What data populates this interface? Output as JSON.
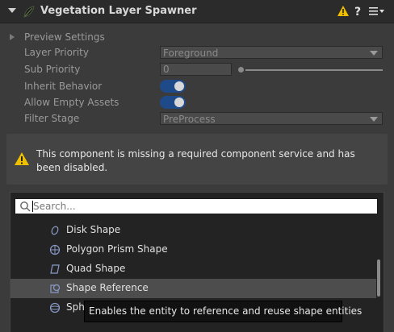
{
  "header": {
    "title": "Vegetation Layer Spawner",
    "warning_icon": "warning-icon",
    "help_icon": "help-icon",
    "menu_icon": "menu-icon"
  },
  "properties": {
    "preview_settings": "Preview Settings",
    "layer_priority": {
      "label": "Layer Priority",
      "value": "Foreground"
    },
    "sub_priority": {
      "label": "Sub Priority",
      "value": "0"
    },
    "inherit_behavior": {
      "label": "Inherit Behavior",
      "on": true
    },
    "allow_empty_assets": {
      "label": "Allow Empty Assets",
      "on": true
    },
    "filter_stage": {
      "label": "Filter Stage",
      "value": "PreProcess"
    }
  },
  "warning": {
    "message": "This component is missing a required component service and has been disabled."
  },
  "picker": {
    "search_placeholder": "Search...",
    "items": [
      {
        "label": "Disk Shape",
        "icon": "disk-shape-icon"
      },
      {
        "label": "Polygon Prism Shape",
        "icon": "polygon-prism-icon"
      },
      {
        "label": "Quad Shape",
        "icon": "quad-shape-icon"
      },
      {
        "label": "Shape Reference",
        "icon": "shape-reference-icon",
        "selected": true
      },
      {
        "label": "Sph",
        "icon": "sphere-shape-icon"
      }
    ],
    "tooltip": "Enables the entity to reference and reuse shape entities"
  },
  "colors": {
    "accent_toggle": "#1f4a8a",
    "warning": "#f0c000",
    "panel": "#3b3b3b"
  }
}
